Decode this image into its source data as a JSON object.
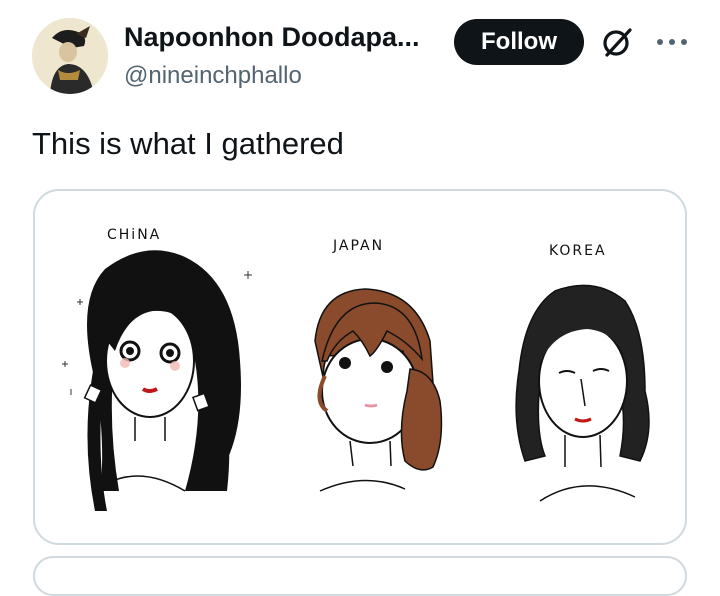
{
  "author": {
    "display_name": "Napoonhon Doodapa...",
    "handle": "@nineinchphallo"
  },
  "actions": {
    "follow_label": "Follow"
  },
  "icons": {
    "avatar": "avatar-portrait",
    "grok": "grok-icon",
    "more": "more-icon"
  },
  "tweet": {
    "text": "This is what I gathered"
  },
  "media": {
    "labels": [
      "CHiNA",
      "JAPAN",
      "KOREA"
    ]
  }
}
